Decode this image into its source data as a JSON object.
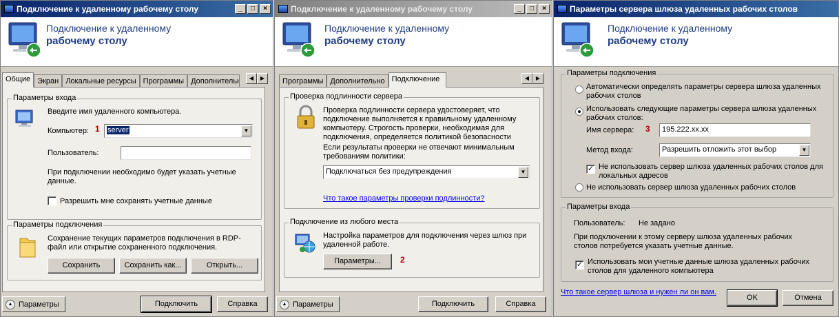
{
  "w1": {
    "title": "Подключение к удаленному рабочему столу",
    "banner1": "Подключение к удаленному",
    "banner2": "рабочему столу",
    "tabs": [
      "Общие",
      "Экран",
      "Локальные ресурсы",
      "Программы",
      "Дополнительно"
    ],
    "login_group": "Параметры входа",
    "login_prompt": "Введите имя удаленного компьютера.",
    "computer_label": "Компьютер:",
    "computer_value": "server",
    "user_label": "Пользователь:",
    "user_value": "",
    "creds_note": "При подключении необходимо будет указать учетные данные.",
    "allow_save": "Разрешить мне сохранять учетные данные",
    "conn_group": "Параметры подключения",
    "conn_note": "Сохранение текущих параметров подключения в RDP-файл или открытие сохраненного подключения.",
    "save": "Сохранить",
    "save_as": "Сохранить как...",
    "open": "Открыть...",
    "options": "Параметры",
    "connect": "Подключить",
    "help": "Справка",
    "marker": "1"
  },
  "w2": {
    "title": "Подключение к удаленному рабочему столу",
    "banner1": "Подключение к удаленному",
    "banner2": "рабочему столу",
    "tabs": [
      "Программы",
      "Дополнительно",
      "Подключение"
    ],
    "auth_group": "Проверка подлинности сервера",
    "auth_desc": "Проверка подлинности сервера удостоверяет, что подключение выполняется к правильному удаленному компьютеру. Строгость проверки, необходимая для подключения, определяется политикой безопасности системы.",
    "auth_policy": "Если результаты проверки не отвечают минимальным требованиям политики:",
    "auth_select": "Подключаться без предупреждения",
    "auth_link": "Что такое параметры проверки подлинности?",
    "anywhere_group": "Подключение из любого места",
    "anywhere_desc": "Настройка параметров для подключения через шлюз при удаленной работе.",
    "params_btn": "Параметры...",
    "options": "Параметры",
    "connect": "Подключить",
    "help": "Справка",
    "marker": "2"
  },
  "w3": {
    "title": "Параметры сервера шлюза удаленных рабочих столов",
    "banner1": "Подключение к удаленному",
    "banner2": "рабочему столу",
    "conn_group": "Параметры подключения",
    "auto_radio": "Автоматически определять параметры сервера шлюза удаленных рабочих столов",
    "use_radio": "Использовать следующие параметры сервера шлюза удаленных рабочих столов:",
    "server_label": "Имя сервера:",
    "server_value": "195.222.xx.xx",
    "method_label": "Метод входа:",
    "method_value": "Разрешить отложить этот выбор",
    "bypass_chk": "Не использовать сервер шлюза удаленных рабочих столов для локальных адресов",
    "no_gw_radio": "Не использовать сервер шлюза удаленных рабочих столов",
    "login_group": "Параметры входа",
    "user_label": "Пользователь:",
    "user_value": "Не задано",
    "creds_note": "При подключении к этому серверу шлюза удаленных рабочих столов потребуется указать учетные данные.",
    "use_creds_chk": "Использовать мои учетные данные шлюза удаленных рабочих столов для удаленного компьютера",
    "link": "Что такое сервер шлюза и нужен ли он вам.",
    "ok": "OK",
    "cancel": "Отмена",
    "marker": "3"
  }
}
